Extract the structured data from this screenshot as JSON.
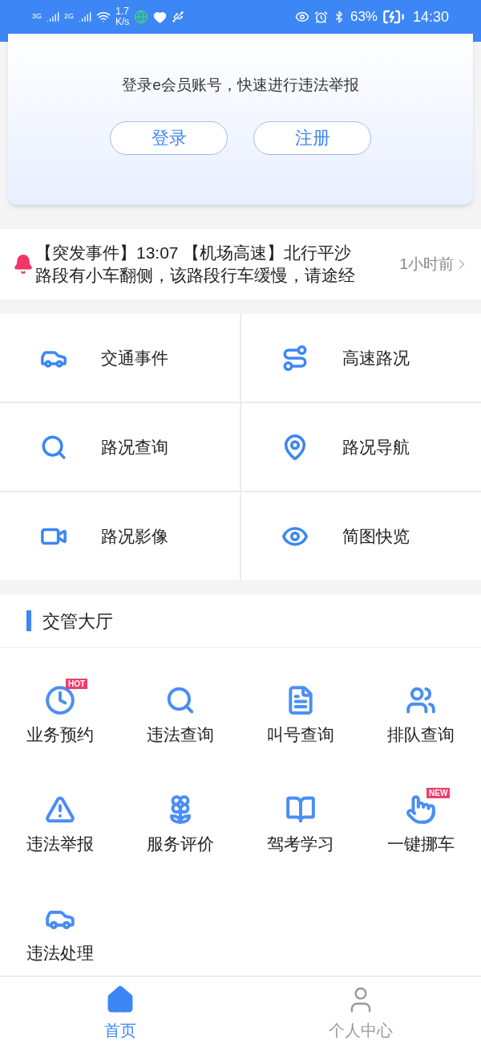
{
  "status_bar": {
    "network_1": "3G",
    "network_2": "2G",
    "speed_value": "1.7",
    "speed_unit": "K/s",
    "battery": "63%",
    "time": "14:30"
  },
  "login_card": {
    "prompt": "登录e会员账号，快速进行违法举报",
    "buttons": [
      "登录",
      "注册"
    ]
  },
  "notice": {
    "text": "【突发事件】13:07 【机场高速】北行平沙路段有小车翻侧，该路段行车缓慢，请途经",
    "time": "1小时前"
  },
  "road_services": [
    {
      "kind": "accident",
      "label": "交通事件"
    },
    {
      "kind": "highway",
      "label": "高速路况"
    },
    {
      "kind": "search",
      "label": "路况查询"
    },
    {
      "kind": "pin",
      "label": "路况导航"
    },
    {
      "kind": "video",
      "label": "路况影像"
    },
    {
      "kind": "eye",
      "label": "简图快览"
    }
  ],
  "hall": {
    "title": "交管大厅",
    "items": [
      {
        "kind": "car-clock",
        "label": "业务预约",
        "badge": "HOT"
      },
      {
        "kind": "search-badge",
        "label": "违法查询"
      },
      {
        "kind": "doc",
        "label": "叫号查询"
      },
      {
        "kind": "users",
        "label": "排队查询"
      },
      {
        "kind": "warning",
        "label": "违法举报"
      },
      {
        "kind": "flower",
        "label": "服务评价"
      },
      {
        "kind": "book",
        "label": "驾考学习"
      },
      {
        "kind": "tap",
        "label": "一键挪车",
        "badge": "NEW"
      },
      {
        "kind": "car-badge",
        "label": "违法处理"
      }
    ]
  },
  "tab_bar": [
    {
      "label": "首页",
      "selected": true
    },
    {
      "label": "个人中心",
      "selected": false
    }
  ]
}
